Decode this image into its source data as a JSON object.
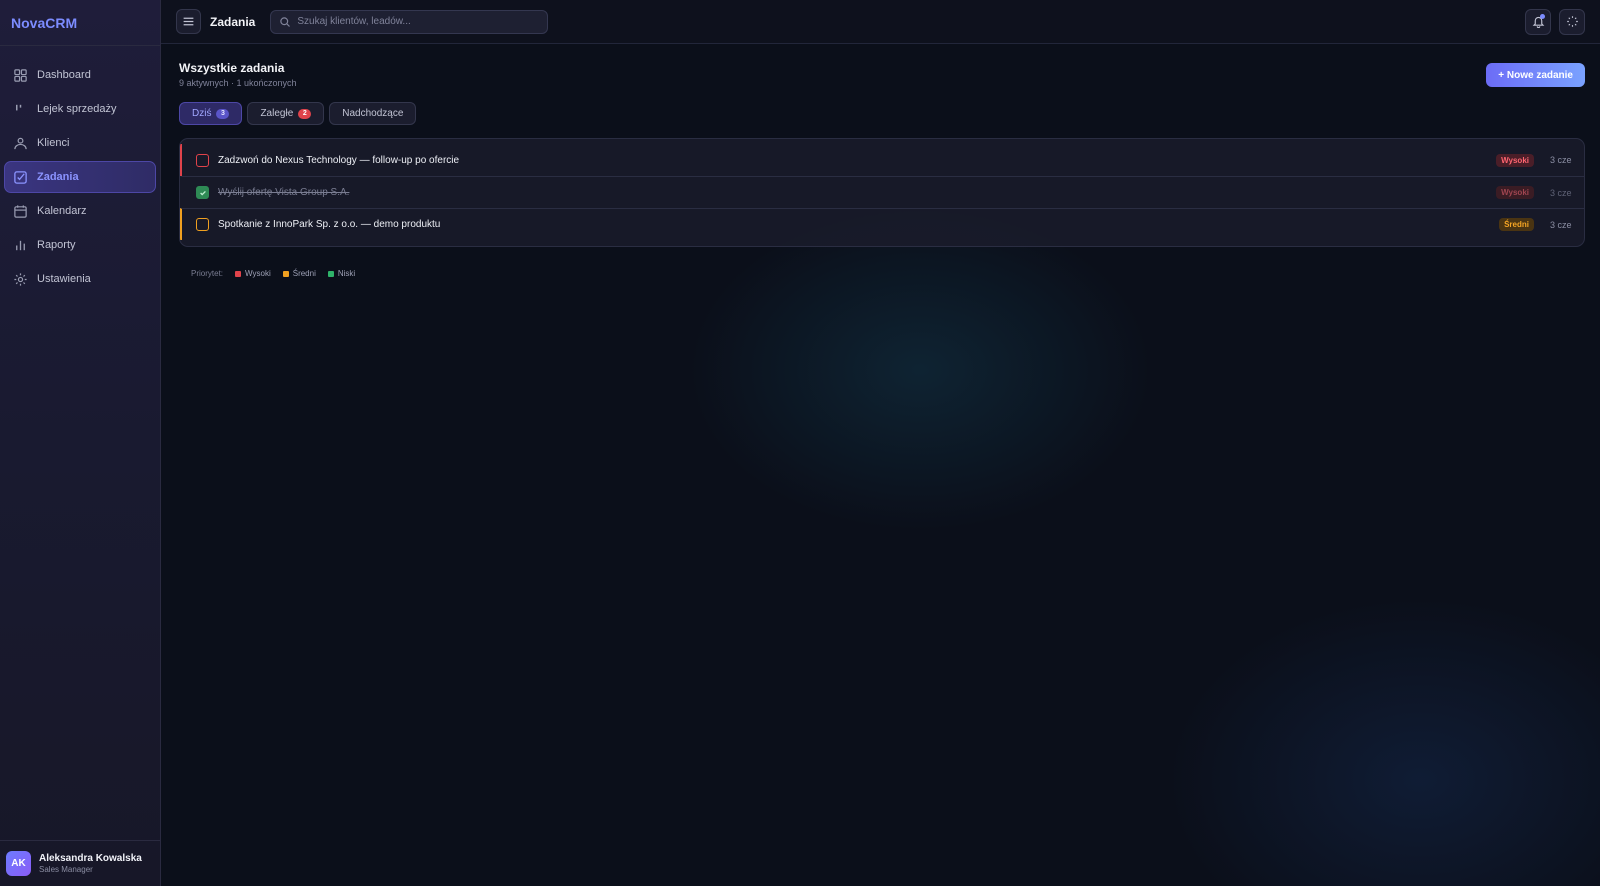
{
  "brand": "NovaCRM",
  "sidebar": {
    "items": [
      {
        "label": "Dashboard",
        "icon": "grid-icon"
      },
      {
        "label": "Lejek sprzedaży",
        "icon": "kanban-icon"
      },
      {
        "label": "Klienci",
        "icon": "users-icon"
      },
      {
        "label": "Zadania",
        "icon": "check-square-icon",
        "active": true
      },
      {
        "label": "Kalendarz",
        "icon": "calendar-icon"
      },
      {
        "label": "Raporty",
        "icon": "bar-chart-icon"
      },
      {
        "label": "Ustawienia",
        "icon": "gear-icon"
      }
    ]
  },
  "user": {
    "initials": "AK",
    "name": "Aleksandra Kowalska",
    "role": "Sales Manager"
  },
  "topbar": {
    "title": "Zadania",
    "search_placeholder": "Szukaj klientów, leadów..."
  },
  "page": {
    "title": "Wszystkie zadania",
    "subtitle": "9 aktywnych · 1 ukończonych",
    "new_button": "+ Nowe zadanie"
  },
  "tabs": [
    {
      "label": "Dziś",
      "count": "3",
      "active": true
    },
    {
      "label": "Zaległe",
      "count": "2"
    },
    {
      "label": "Nadchodzące"
    }
  ],
  "tasks": [
    {
      "title": "Zadzwoń do Nexus Technology — follow-up po ofercie",
      "priority": "Wysoki",
      "due": "3 cze",
      "done": false
    },
    {
      "title": "Wyślij ofertę Vista Group S.A.",
      "priority": "Wysoki",
      "due": "3 cze",
      "done": true
    },
    {
      "title": "Spotkanie z InnoPark Sp. z o.o. — demo produktu",
      "priority": "Średni",
      "due": "3 cze",
      "done": false
    }
  ],
  "legend": {
    "label": "Priorytet:",
    "items": [
      {
        "label": "Wysoki",
        "color": "#e0434b"
      },
      {
        "label": "Średni",
        "color": "#f0a020"
      },
      {
        "label": "Niski",
        "color": "#2fb36a"
      }
    ]
  },
  "colors": {
    "accent": "#7c8cff",
    "high": "#e0434b",
    "medium": "#f0a020",
    "low": "#2fb36a"
  }
}
